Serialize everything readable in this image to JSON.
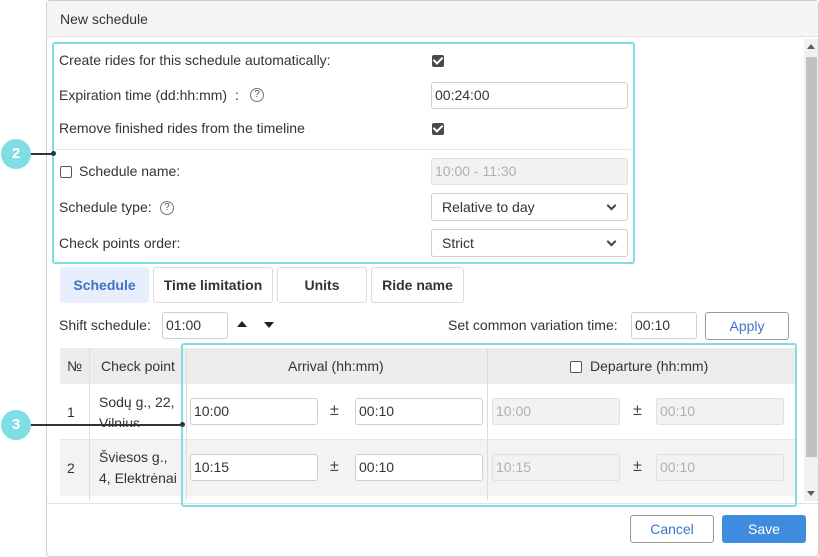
{
  "dialog": {
    "title": "New schedule"
  },
  "settings": {
    "auto_create_label": "Create rides for this schedule automatically:",
    "auto_create_checked": true,
    "expiration_label": "Expiration time (dd:hh:mm)",
    "expiration_colon": ":",
    "expiration_value": "00:24:00",
    "remove_finished_label": "Remove finished rides from the timeline",
    "remove_finished_checked": true,
    "schedule_name_label": "Schedule name:",
    "schedule_name_checked": false,
    "schedule_name_value": "10:00 - 11:30",
    "schedule_type_label": "Schedule type:",
    "schedule_type_value": "Relative to day",
    "checkpoints_order_label": "Check points order:",
    "checkpoints_order_value": "Strict",
    "help_glyph": "?"
  },
  "tabs": [
    {
      "label": "Schedule",
      "active": true
    },
    {
      "label": "Time limitation",
      "active": false
    },
    {
      "label": "Units",
      "active": false
    },
    {
      "label": "Ride name",
      "active": false
    }
  ],
  "shift": {
    "label": "Shift schedule:",
    "value": "01:00",
    "variation_label": "Set common variation time:",
    "variation_value": "00:10",
    "apply_label": "Apply"
  },
  "table": {
    "headers": {
      "number": "№",
      "check_point": "Check point",
      "arrival": "Arrival (hh:mm)",
      "departure": "Departure (hh:mm)"
    },
    "departure_checked": false,
    "pm_symbol": "±",
    "rows": [
      {
        "number": "1",
        "check_point_line1": "Sodų g., 22,",
        "check_point_line2": "Vilnius",
        "arrival": "10:00",
        "arrival_var": "00:10",
        "departure": "10:00",
        "departure_var": "00:10"
      },
      {
        "number": "2",
        "check_point_line1": "Šviesos g.,",
        "check_point_line2": "4, Elektrėnai",
        "arrival": "10:15",
        "arrival_var": "00:10",
        "departure": "10:15",
        "departure_var": "00:10"
      }
    ]
  },
  "footer": {
    "cancel_label": "Cancel",
    "save_label": "Save"
  },
  "callouts": {
    "two": "2",
    "three": "3"
  },
  "colors": {
    "accent": "#3f8cde",
    "callout": "#7fdde6"
  }
}
